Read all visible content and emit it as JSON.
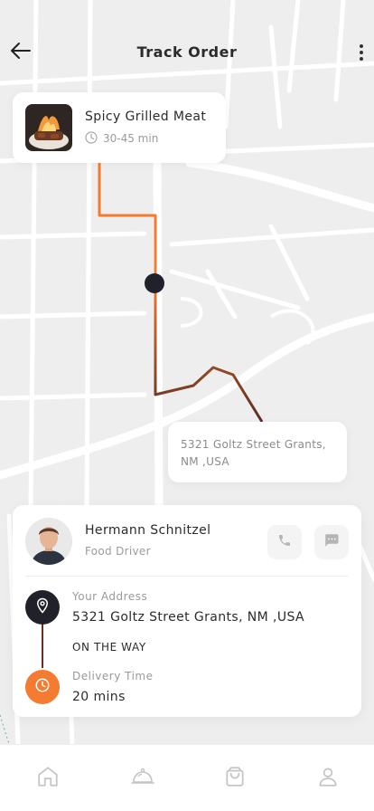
{
  "header": {
    "title": "Track Order",
    "back_icon": "arrow-left-icon",
    "menu_icon": "more-vertical-icon"
  },
  "food_card": {
    "name": "Spicy Grilled Meat",
    "time": "30-45 min",
    "time_icon": "clock-icon"
  },
  "map": {
    "destination_bubble": "5321 Goltz Street Grants, NM ,USA",
    "route_color_start": "#f47b30",
    "route_color_end": "#5a2d22",
    "courier_marker_color": "#20212a"
  },
  "driver": {
    "name": "Hermann Schnitzel",
    "role": "Food Driver",
    "call_icon": "phone-icon",
    "message_icon": "message-icon"
  },
  "delivery": {
    "address_label": "Your Address",
    "address_value": "5321 Goltz Street Grants, NM ,USA",
    "status": "ON THE WAY",
    "time_label": "Delivery Time",
    "time_value": "20 mins",
    "address_icon": "map-pin-icon",
    "time_icon": "clock-icon"
  },
  "bottom_nav": {
    "items": [
      "home-icon",
      "cloche-icon",
      "shopping-bag-icon",
      "user-icon"
    ]
  },
  "colors": {
    "accent": "#f47b30",
    "dark": "#20212a",
    "background": "#eeeeee"
  }
}
